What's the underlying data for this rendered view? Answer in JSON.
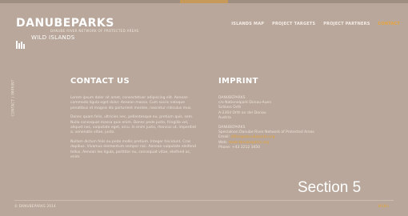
{
  "logo": {
    "title": "DANUBEPARKS",
    "tagline": "DANUBE RIVER NETWORK OF PROTECTED AREAS",
    "subtitle": "WILD ISLANDS"
  },
  "nav": {
    "items": [
      {
        "label": "ISLANDS MAP"
      },
      {
        "label": "PROJECT TARGETS"
      },
      {
        "label": "PROJECT PARTNERS"
      },
      {
        "label": "CONTACT"
      }
    ],
    "active_color": "#e9a53b"
  },
  "side_label": "CONTACT / IMPRINT",
  "contact": {
    "heading": "CONTACT US",
    "paragraphs": [
      "Lorem ipsum dolor sit amet, consectetuer adipiscing elit. Aenean commodo ligula eget dolor. Aenean massa. Cum sociis natoque penatibus et magnis dis parturient montes, nascetur ridiculus mus.",
      "Donec quam felis, ultricies nec, pellentesque eu, pretium quis, sem. Nulla consequat massa quis enim. Donec pede justo, fringilla vel, aliquet nec, vulputate eget, arcu. In enim justo, rhoncus ut, imperdiet a, venenatis vitae, justo.",
      "Nullam dictum felis eu pede mollis pretium. Integer tincidunt. Cras dapibus. Vivamus elementum semper nisi. Aenean vulputate eleifend tellus. Aenean leo ligula, porttitor eu, consequat vitae, eleifend ac, enim."
    ]
  },
  "imprint": {
    "heading": "IMPRINT",
    "lines_a": [
      "DANUBEPARKS",
      "c/o Nationalpark Donau-Auen",
      "Schloss Orth",
      "A-2304 Orth an der Donau",
      "Austria"
    ],
    "lines_b": [
      "DANUBEPARKS",
      "Specialnon Danube River Network of Protected Areas"
    ],
    "email_label": "Email:",
    "email": "office@danubeparks.org",
    "web_label": "Web:",
    "web": "www.danubeparks.org",
    "phone": "Phone: +43 2212 3450"
  },
  "section_label": "Section 5",
  "footer": {
    "left": "© DANUBEPARKS 2014",
    "right": "MENU"
  },
  "colors": {
    "background": "#b8a79a",
    "accent": "#e9a53b"
  }
}
